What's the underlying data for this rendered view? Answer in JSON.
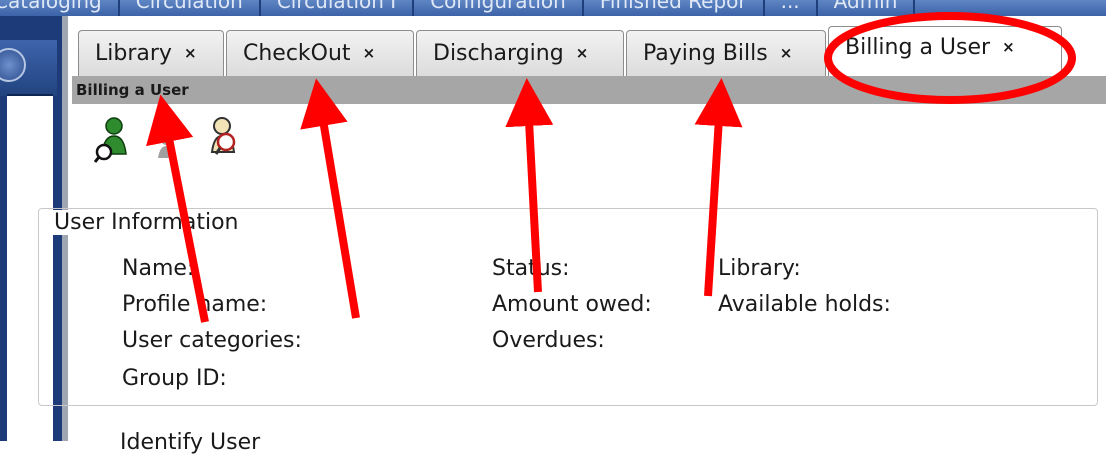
{
  "menu": {
    "items": [
      "Cataloging",
      "Circulation",
      "Circulation I",
      "Configuration",
      "Finished Repor",
      "...",
      "Admin"
    ]
  },
  "tabs": [
    {
      "label": "Library",
      "close": "×"
    },
    {
      "label": "CheckOut",
      "close": "×"
    },
    {
      "label": "Discharging",
      "close": "×"
    },
    {
      "label": "Paying Bills",
      "close": "×"
    },
    {
      "label": "Billing a User",
      "close": "×",
      "active": true
    }
  ],
  "panel": {
    "title": "Billing a User"
  },
  "toolbar": {
    "icons": [
      "user-search-icon",
      "user-gray-icon",
      "user-lookup-icon"
    ]
  },
  "user_info": {
    "legend": "User Information",
    "col1": [
      "Name:",
      "Profile name:",
      "User categories:",
      "Group ID:"
    ],
    "col2": [
      "Status:",
      "Amount owed:",
      "Overdues:"
    ],
    "col3": [
      "Library:",
      "Available holds:"
    ]
  },
  "next_section": {
    "legend": "Identify User"
  },
  "colors": {
    "annotation": "#ff0000",
    "accent": "#1d3b78",
    "panelbar": "#a6a6a6"
  }
}
